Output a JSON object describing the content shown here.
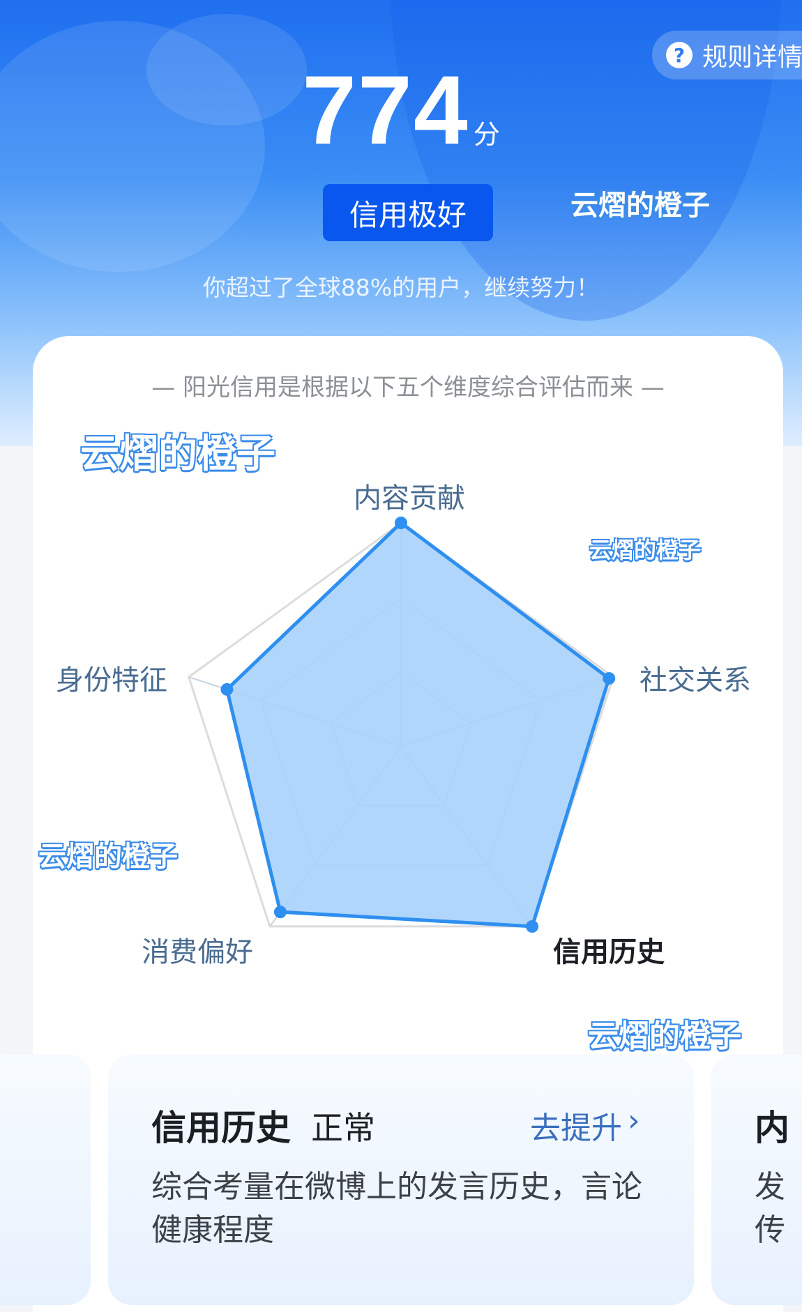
{
  "header": {
    "rules_label": "规则详情",
    "score": "774",
    "score_unit": "分",
    "level": "信用极好",
    "surpass_text": "你超过了全球88%的用户，继续努力！"
  },
  "dimensions_caption": "— 阳光信用是根据以下五个维度综合评估而来 —",
  "watermark": "云熠的橙子",
  "radar": {
    "axes": [
      {
        "label": "内容贡献",
        "value": 1.0
      },
      {
        "label": "社交关系",
        "value": 0.98
      },
      {
        "label": "信用历史",
        "value": 1.0
      },
      {
        "label": "消费偏好",
        "value": 0.92
      },
      {
        "label": "身份特征",
        "value": 0.82
      }
    ],
    "active_axis": "信用历史",
    "colors": {
      "fill": "#a9d1fb",
      "stroke": "#2e8ff0",
      "grid": "#c7d3e0",
      "outer": "#dcdcdc"
    }
  },
  "detail": {
    "title": "信用历史",
    "status": "正常",
    "improve_label": "去提升",
    "description": "综合考量在微博上的发言历史，言论健康程度"
  },
  "next_card": {
    "title_fragment": "内",
    "desc_fragment": "发传"
  }
}
